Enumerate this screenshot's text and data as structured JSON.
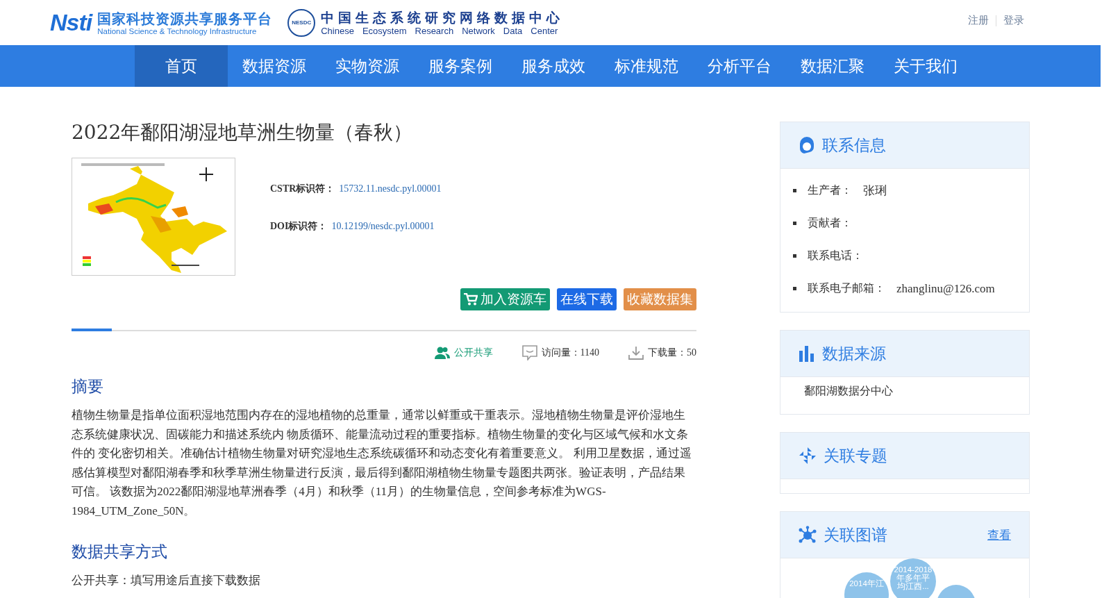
{
  "header": {
    "platform_logo": "Nsti",
    "platform_name": "国家科技资源共享服务平台",
    "platform_name_en": "National Science & Technology Infrastructure",
    "center_badge": "NESDC",
    "center_name": "中国生态系统研究网络数据中心",
    "center_name_en": [
      "Chinese",
      "Ecosystem",
      "Research",
      "Network",
      "Data",
      "Center"
    ],
    "links": [
      "注册",
      "登录"
    ]
  },
  "nav": [
    {
      "label": "首页",
      "selected": true
    },
    {
      "label": "数据资源",
      "selected": false
    },
    {
      "label": "实物资源",
      "selected": false
    },
    {
      "label": "服务案例",
      "selected": false
    },
    {
      "label": "服务成效",
      "selected": false
    },
    {
      "label": "标准规范",
      "selected": false
    },
    {
      "label": "分析平台",
      "selected": false
    },
    {
      "label": "数据汇聚",
      "selected": false
    },
    {
      "label": "关于我们",
      "selected": false
    }
  ],
  "dataset": {
    "title": "2022年鄱阳湖湿地草洲生物量（春秋）",
    "identifiers": [
      {
        "label": "CSTR标识符：",
        "value": "15732.11.nesdc.pyl.00001"
      },
      {
        "label": "DOI标识符：",
        "value": "10.12199/nesdc.pyl.00001"
      }
    ],
    "actions": [
      {
        "label": "加入资源车",
        "kind": "cart",
        "color": "#139a74"
      },
      {
        "label": "在线下载",
        "kind": "plain",
        "color": "#1d6ae5"
      },
      {
        "label": "收藏数据集",
        "kind": "plain",
        "color": "#e28f49"
      }
    ],
    "stats": [
      {
        "kind": "share",
        "text": "公开共享"
      },
      {
        "kind": "visits",
        "text": "访问量：1140"
      },
      {
        "kind": "downloads",
        "text": "下载量：50"
      }
    ],
    "sections": [
      {
        "heading": "摘要",
        "body": "植物生物量是指单位面积湿地范围内存在的湿地植物的总重量，通常以鲜重或干重表示。湿地植物生物量是评价湿地生态系统健康状况、固碳能力和描述系统内 物质循环、能量流动过程的重要指标。植物生物量的变化与区域气候和水文条件的 变化密切相关。准确估计植物生物量对研究湿地生态系统碳循环和动态变化有着重要意义。 利用卫星数据，通过遥感估算模型对鄱阳湖春季和秋季草洲生物量进行反演，最后得到鄱阳湖植物生物量专题图共两张。验证表明，产品结果可信。 该数据为2022鄱阳湖湿地草洲春季（4月）和秋季（11月）的生物量信息，空间参考标准为WGS-1984_UTM_Zone_50N。"
      },
      {
        "heading": "数据共享方式",
        "body": "公开共享：填写用途后直接下载数据"
      }
    ]
  },
  "sidebar": [
    {
      "kind": "contact",
      "title": "联系信息",
      "items": [
        {
          "label": "生产者：",
          "value": "张琍"
        },
        {
          "label": "贡献者："
        },
        {
          "label": "联系电话："
        },
        {
          "label": "联系电子邮箱：",
          "value": "zhanglinu@126.com"
        }
      ]
    },
    {
      "kind": "source",
      "title": "数据来源",
      "text": "鄱阳湖数据分中心"
    },
    {
      "kind": "topic",
      "title": "关联专题"
    },
    {
      "kind": "graph",
      "title": "关联图谱",
      "link": "查看",
      "bubbles": [
        {
          "kind": "node",
          "text": "2014年江"
        },
        {
          "kind": "node",
          "text": "2014-2018年多年平均江西..."
        },
        {
          "kind": "node"
        }
      ]
    }
  ]
}
